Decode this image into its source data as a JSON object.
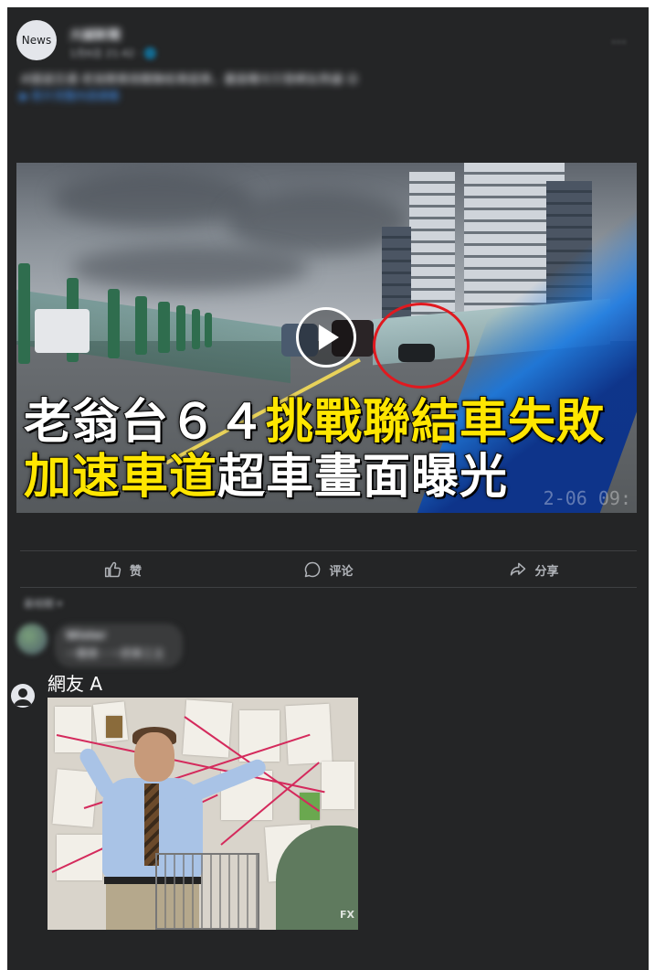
{
  "post": {
    "avatar_label": "News",
    "page_name": "大誠新聞",
    "meta": "1月6日 21:42 · 🌐",
    "more": "···",
    "caption_line1": "#國道交通 老翁開車挑戰聯結車超車，畫面曝光引發網友熱議 😮",
    "caption_line2": "▶ 影片完整內容請看",
    "video": {
      "headline_line1_white": "老翁台６４",
      "headline_line1_yellow": "挑戰聯結車失敗",
      "headline_line2_yellow": "加速車道",
      "headline_line2_white": "超車畫面曝光",
      "timestamp_watermark": "2-06 09:"
    }
  },
  "actions": {
    "like": "赞",
    "comment": "评论",
    "share": "分享"
  },
  "comments": {
    "sort_label": "最相關 ▾",
    "first": {
      "name": "Wister",
      "text": "一顆車・一把車工主"
    },
    "reply": {
      "user_name": "網友 A",
      "image_caption": "FX"
    }
  },
  "colors": {
    "card_bg": "#242526",
    "text_secondary": "#b0b3b8",
    "headline_yellow": "#ffe600",
    "highlight_red": "#e0191f"
  }
}
